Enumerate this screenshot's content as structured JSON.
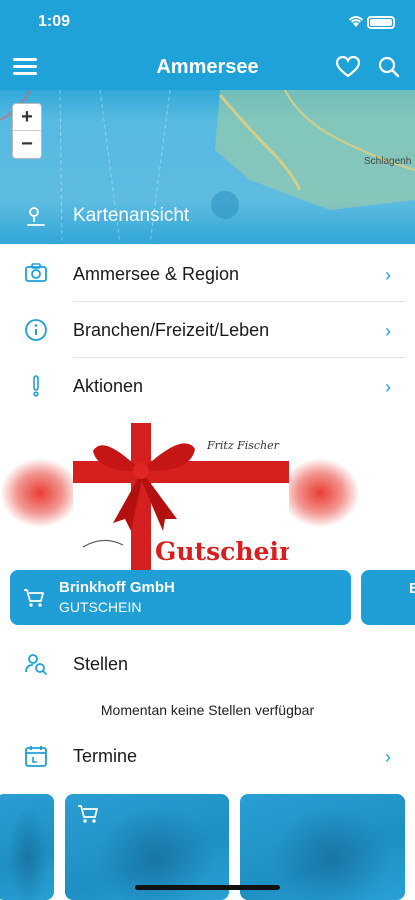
{
  "status": {
    "time": "1:09"
  },
  "navbar": {
    "title": "Ammersee"
  },
  "map": {
    "place_label": "Schlagenh",
    "zoom_in": "+",
    "zoom_out": "−"
  },
  "kartenansicht": {
    "label": "Kartenansicht"
  },
  "menu": [
    {
      "label": "Ammersee & Region",
      "icon": "camera-icon"
    },
    {
      "label": "Branchen/Freizeit/Leben",
      "icon": "info-icon"
    },
    {
      "label": "Aktionen",
      "icon": "exclamation-icon"
    }
  ],
  "chevron": "›",
  "voucher": {
    "name": "Brinkhoff GmbH",
    "type": "GUTSCHEIN",
    "image_text": "Gutschein",
    "image_signature": "Fritz Fischer",
    "next_peek": "B"
  },
  "stellen": {
    "label": "Stellen",
    "note": "Momentan keine Stellen verfügbar"
  },
  "termine": {
    "label": "Termine"
  },
  "colors": {
    "primary": "#1f9fd6",
    "voucher_red": "#d61f1f"
  }
}
